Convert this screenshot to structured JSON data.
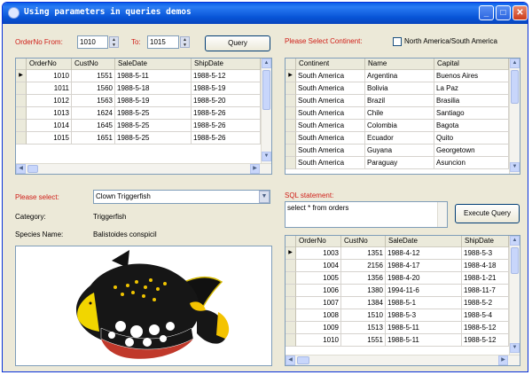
{
  "window": {
    "title": "Using parameters in queries demos"
  },
  "orders_filter": {
    "from_label": "OrderNo From:",
    "from_value": "1010",
    "to_label": "To:",
    "to_value": "1015",
    "query_button": "Query"
  },
  "orders_grid": {
    "columns": [
      "OrderNo",
      "CustNo",
      "SaleDate",
      "ShipDate"
    ],
    "rows": [
      [
        "1010",
        "1551",
        "1988-5-11",
        "1988-5-12"
      ],
      [
        "1011",
        "1560",
        "1988-5-18",
        "1988-5-19"
      ],
      [
        "1012",
        "1563",
        "1988-5-19",
        "1988-5-20"
      ],
      [
        "1013",
        "1624",
        "1988-5-25",
        "1988-5-26"
      ],
      [
        "1014",
        "1645",
        "1988-5-25",
        "1988-5-26"
      ],
      [
        "1015",
        "1651",
        "1988-5-25",
        "1988-5-26"
      ]
    ]
  },
  "continent": {
    "label": "Please Select Continent:",
    "checkbox_label": "North America/South America"
  },
  "country_grid": {
    "columns": [
      "Continent",
      "Name",
      "Capital"
    ],
    "rows": [
      [
        "South America",
        "Argentina",
        "Buenos Aires"
      ],
      [
        "South America",
        "Bolivia",
        "La Paz"
      ],
      [
        "South America",
        "Brazil",
        "Brasilia"
      ],
      [
        "South America",
        "Chile",
        "Santiago"
      ],
      [
        "South America",
        "Colombia",
        "Bagota"
      ],
      [
        "South America",
        "Ecuador",
        "Quito"
      ],
      [
        "South America",
        "Guyana",
        "Georgetown"
      ],
      [
        "South America",
        "Paraguay",
        "Asuncion"
      ]
    ]
  },
  "fish": {
    "select_label": "Please select:",
    "selected": "Clown Triggerfish",
    "category_label": "Category:",
    "category_value": "Triggerfish",
    "species_label": "Species Name:",
    "species_value": "Balistoides conspicil"
  },
  "sql": {
    "label": "SQL statement:",
    "value": "select * from orders",
    "execute_button": "Execute Query"
  },
  "sql_grid": {
    "columns": [
      "OrderNo",
      "CustNo",
      "SaleDate",
      "ShipDate"
    ],
    "rows": [
      [
        "1003",
        "1351",
        "1988-4-12",
        "1988-5-3"
      ],
      [
        "1004",
        "2156",
        "1988-4-17",
        "1988-4-18"
      ],
      [
        "1005",
        "1356",
        "1988-4-20",
        "1988-1-21"
      ],
      [
        "1006",
        "1380",
        "1994-11-6",
        "1988-11-7"
      ],
      [
        "1007",
        "1384",
        "1988-5-1",
        "1988-5-2"
      ],
      [
        "1008",
        "1510",
        "1988-5-3",
        "1988-5-4"
      ],
      [
        "1009",
        "1513",
        "1988-5-11",
        "1988-5-12"
      ],
      [
        "1010",
        "1551",
        "1988-5-11",
        "1988-5-12"
      ]
    ]
  }
}
